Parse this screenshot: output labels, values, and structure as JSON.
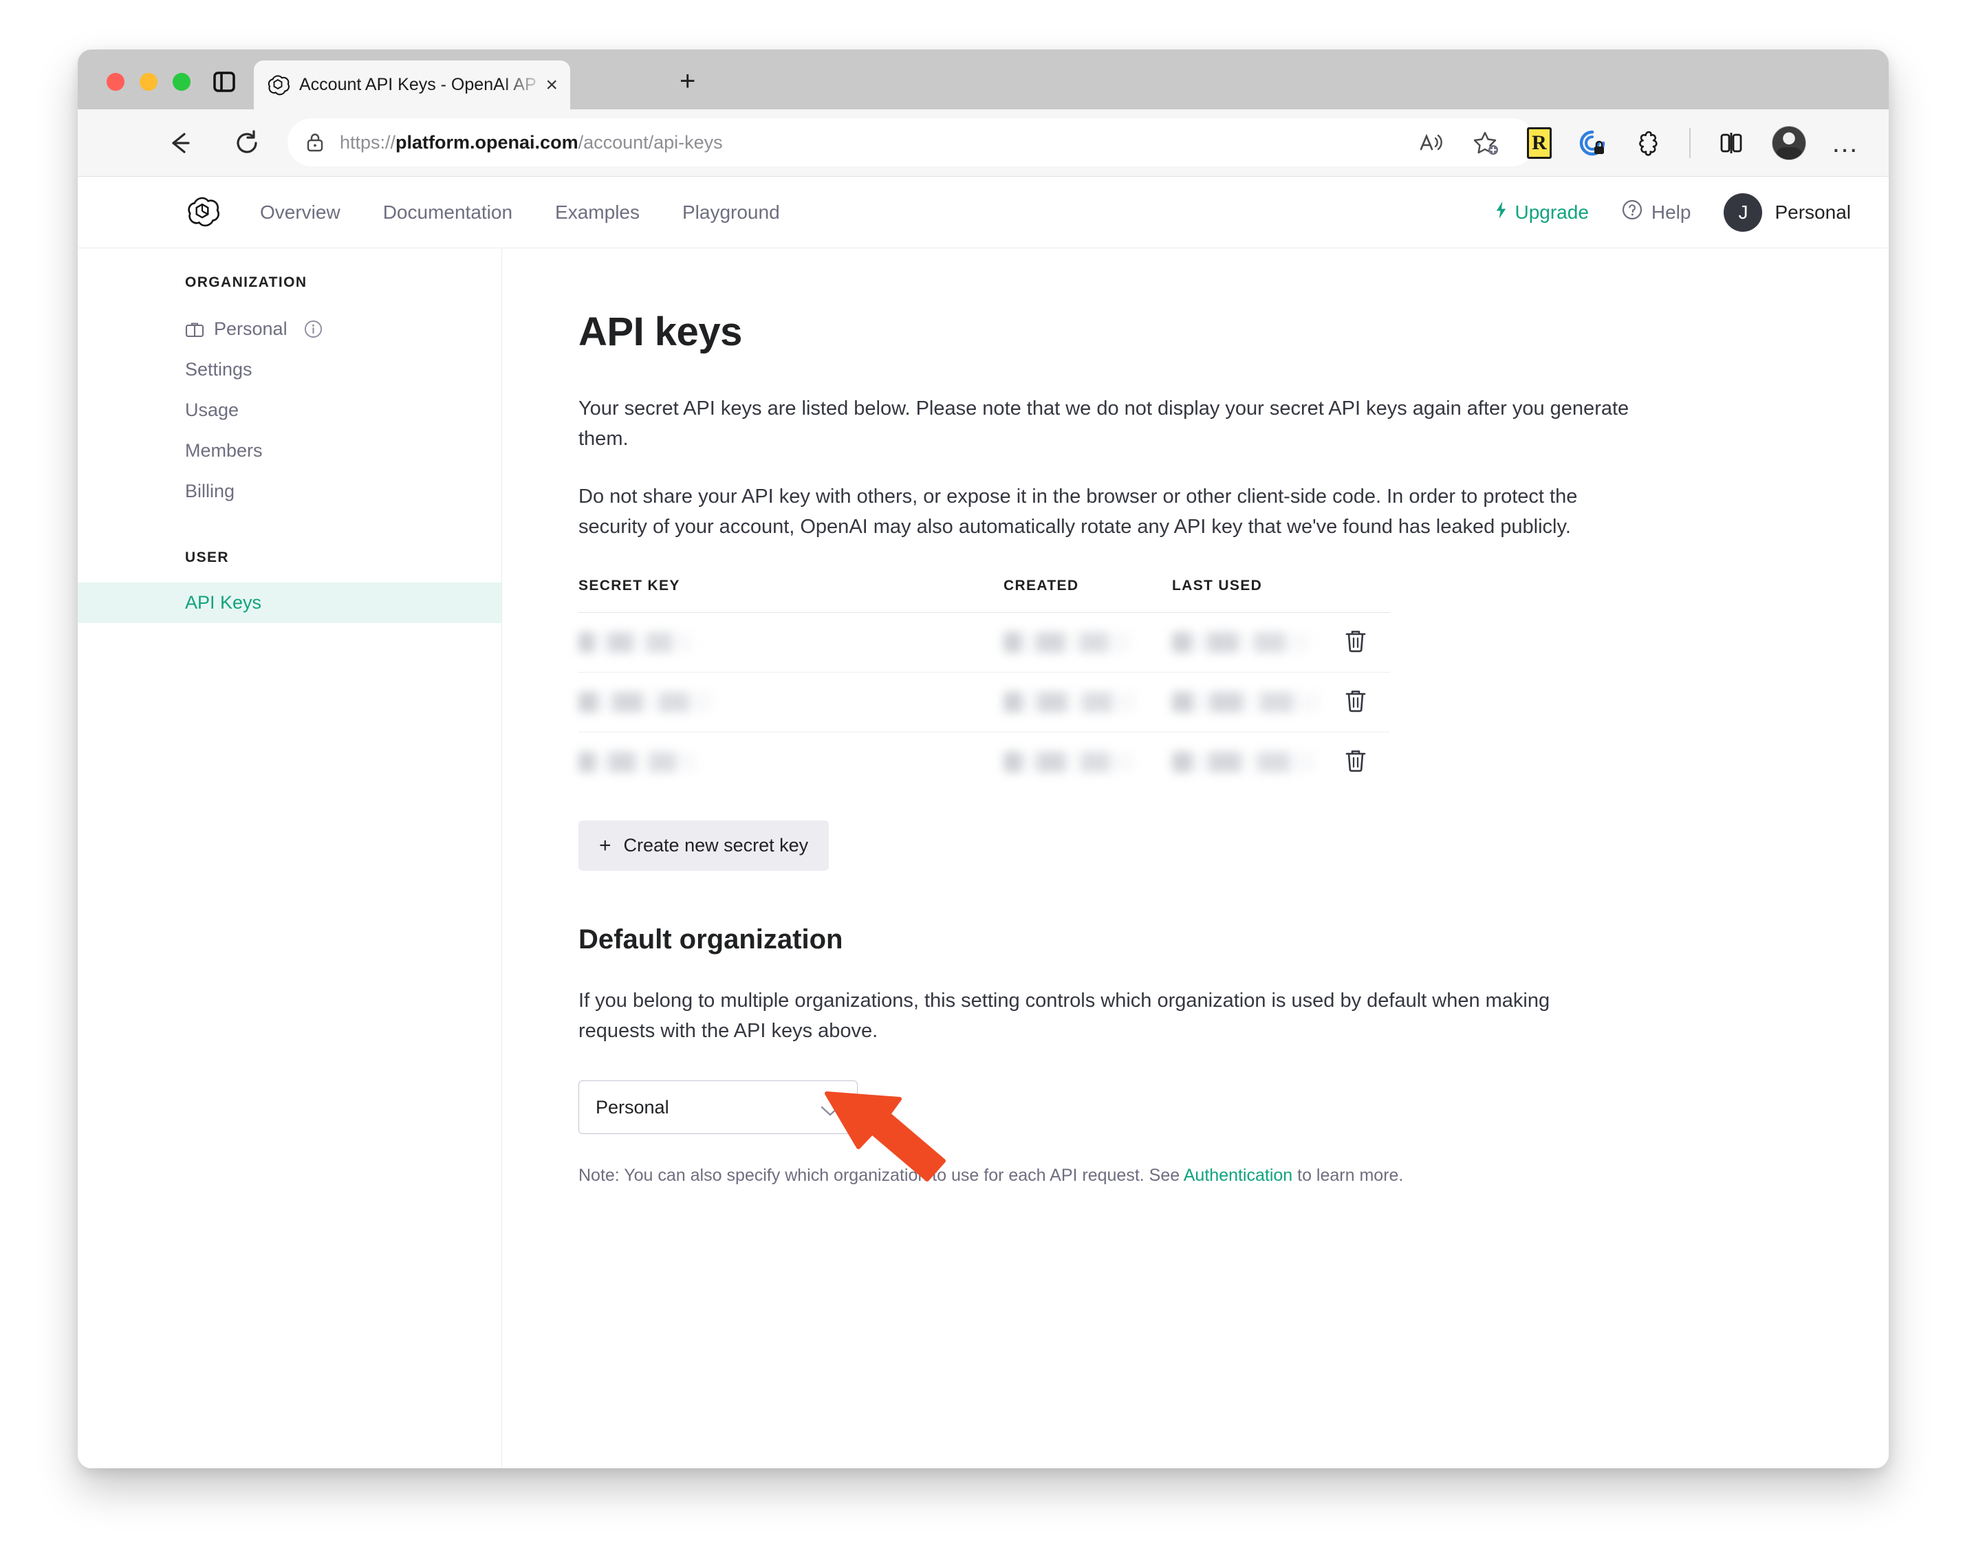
{
  "browser": {
    "tab": {
      "title": "Account API Keys - OpenAI AP",
      "close_label": "×",
      "favicon": "openai-logo-icon"
    },
    "new_tab_label": "+",
    "back_label": "back-arrow-icon",
    "reload_label": "reload-icon",
    "url": {
      "scheme": "https://",
      "host": "platform.openai.com",
      "path": "/account/api-keys"
    },
    "extensions": [
      {
        "name": "read-aloud-icon",
        "label": "A"
      },
      {
        "name": "favorites-add-icon",
        "label": "☆"
      },
      {
        "name": "extension-r-badge",
        "label": "R"
      },
      {
        "name": "privacy-lock-icon",
        "label": ""
      },
      {
        "name": "extensions-puzzle-icon",
        "label": ""
      },
      {
        "name": "split-screen-icon",
        "label": ""
      },
      {
        "name": "profile-avatar",
        "label": ""
      },
      {
        "name": "browser-settings-menu",
        "label": "…"
      }
    ]
  },
  "topnav": {
    "logo": "openai-logo-icon",
    "links": [
      "Overview",
      "Documentation",
      "Examples",
      "Playground"
    ],
    "upgrade_label": "Upgrade",
    "help_label": "Help",
    "account_initial": "J",
    "account_name": "Personal"
  },
  "sidebar": {
    "org_heading": "ORGANIZATION",
    "org_items": [
      {
        "label": "Personal",
        "icon": "briefcase-icon",
        "info": true
      },
      {
        "label": "Settings"
      },
      {
        "label": "Usage"
      },
      {
        "label": "Members"
      },
      {
        "label": "Billing"
      }
    ],
    "user_heading": "USER",
    "user_items": [
      {
        "label": "API Keys",
        "active": true
      }
    ]
  },
  "main": {
    "title": "API keys",
    "paragraph1": "Your secret API keys are listed below. Please note that we do not display your secret API keys again after you generate them.",
    "paragraph2": "Do not share your API key with others, or expose it in the browser or other client-side code. In order to protect the security of your account, OpenAI may also automatically rotate any API key that we've found has leaked publicly.",
    "table": {
      "columns": [
        "SECRET KEY",
        "CREATED",
        "LAST USED"
      ],
      "rows": [
        {
          "secret_key": "",
          "created": "",
          "last_used": "",
          "redacted": true,
          "delete_icon": "trash-icon"
        },
        {
          "secret_key": "",
          "created": "",
          "last_used": "",
          "redacted": true,
          "delete_icon": "trash-icon"
        },
        {
          "secret_key": "",
          "created": "",
          "last_used": "",
          "redacted": true,
          "delete_icon": "trash-icon"
        }
      ]
    },
    "create_button": {
      "plus": "+",
      "label": "Create new secret key"
    },
    "default_org": {
      "heading": "Default organization",
      "description": "If you belong to multiple organizations, this setting controls which organization is used by default when making requests with the API keys above.",
      "selected": "Personal",
      "note_prefix": "Note: You can also specify which organization to use for each API request. See ",
      "note_link": "Authentication",
      "note_suffix": " to learn more."
    }
  },
  "annotation": {
    "arrow_color": "#f04a23",
    "points_to": "create-new-secret-key-button"
  },
  "colors": {
    "accent_green": "#10a37f",
    "active_bg": "#e7f6f2",
    "text_dark": "#202123",
    "text_body": "#353740",
    "text_muted": "#6e6e80",
    "arrow": "#f04a23"
  }
}
